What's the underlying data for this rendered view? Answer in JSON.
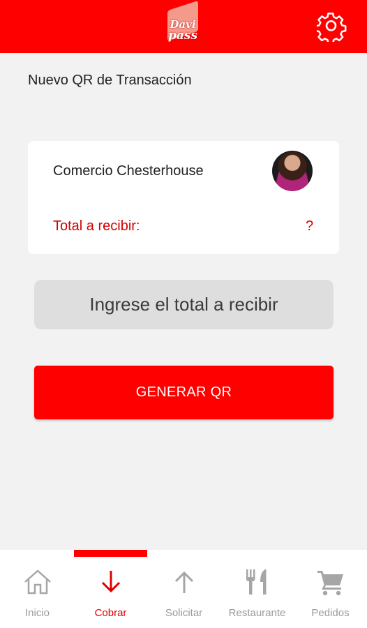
{
  "header": {
    "logo_line1": "Davi",
    "logo_line2": "pass",
    "colors": {
      "primary": "#ff0000",
      "flag": "#f39a8a"
    }
  },
  "page": {
    "title": "Nuevo QR de Transacción"
  },
  "merchant_card": {
    "name": "Comercio Chesterhouse",
    "total_label": "Total a recibir:",
    "total_value": "?"
  },
  "amount_input": {
    "placeholder": "Ingrese el total a recibir",
    "value": ""
  },
  "generate_button": {
    "label": "GENERAR QR"
  },
  "tabbar": {
    "active": "Cobrar",
    "items": [
      {
        "label": "Inicio",
        "icon": "home-icon"
      },
      {
        "label": "Cobrar",
        "icon": "arrow-down-icon"
      },
      {
        "label": "Solicitar",
        "icon": "arrow-up-icon"
      },
      {
        "label": "Restaurante",
        "icon": "fork-knife-icon"
      },
      {
        "label": "Pedidos",
        "icon": "cart-icon"
      }
    ]
  }
}
